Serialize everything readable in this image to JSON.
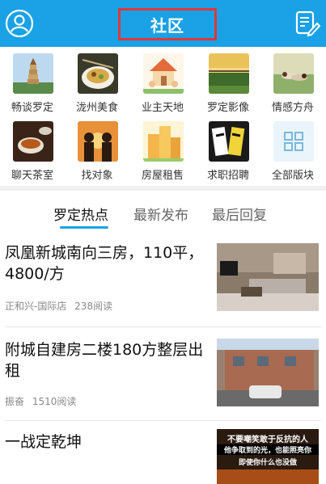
{
  "header": {
    "title": "社区",
    "left_icon": "user-icon",
    "right_icon": "edit-icon"
  },
  "forums": [
    {
      "label": "畅谈罗定"
    },
    {
      "label": "泷州美食"
    },
    {
      "label": "业主天地"
    },
    {
      "label": "罗定影像"
    },
    {
      "label": "情感方舟"
    },
    {
      "label": "聊天茶室"
    },
    {
      "label": "找对象"
    },
    {
      "label": "房屋租售"
    },
    {
      "label": "求职招聘"
    },
    {
      "label": "全部版块"
    }
  ],
  "tabs": [
    {
      "label": "罗定热点"
    },
    {
      "label": "最新发布"
    },
    {
      "label": "最后回复"
    }
  ],
  "posts": [
    {
      "title": "凤凰新城南向三房，110平，4800/方",
      "author": "正和兴-国际店",
      "reads": "238阅读"
    },
    {
      "title": "附城自建房二楼180方整层出租",
      "author": "振奋",
      "reads": "1510阅读"
    },
    {
      "title": "一战定乾坤",
      "image_text": [
        "不要嘲笑敢于反抗的人",
        "他争取到的光，也能照亮你",
        "即使你什么也没做"
      ]
    }
  ],
  "colors": {
    "accent": "#1aa1e6",
    "highlight_border": "#e0383a"
  }
}
